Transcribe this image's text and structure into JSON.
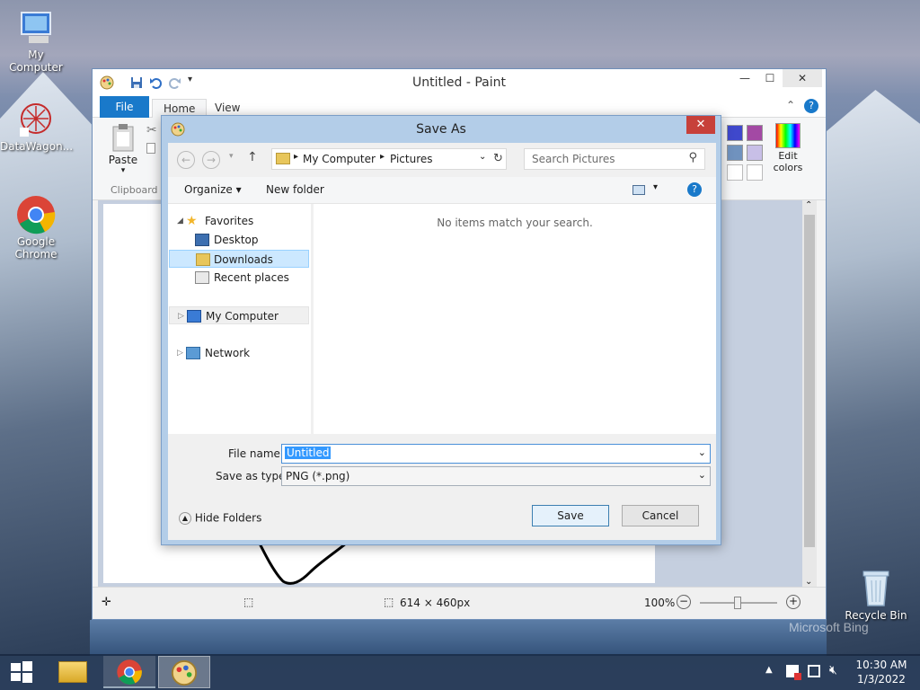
{
  "desktop": {
    "icons": [
      {
        "label": "My Computer"
      },
      {
        "label": "DataWagon..."
      },
      {
        "label_line1": "Google",
        "label_line2": "Chrome"
      },
      {
        "label": "Recycle Bin"
      }
    ],
    "watermark": "Microsoft Bing"
  },
  "paint": {
    "title": "Untitled - Paint",
    "tabs": {
      "file": "File",
      "home": "Home",
      "view": "View"
    },
    "clipboard": {
      "paste": "Paste",
      "group": "Clipboard"
    },
    "edit_colors": {
      "line1": "Edit",
      "line2": "colors"
    },
    "status": {
      "dimensions": "614 × 460px",
      "zoom": "100%"
    }
  },
  "dialog": {
    "title": "Save As",
    "breadcrumb": [
      "My Computer",
      "Pictures"
    ],
    "search_placeholder": "Search Pictures",
    "organize": "Organize",
    "new_folder": "New folder",
    "nav": {
      "favorites": "Favorites",
      "desktop": "Desktop",
      "downloads": "Downloads",
      "recent": "Recent places",
      "computer": "My Computer",
      "network": "Network"
    },
    "empty_message": "No items match your search.",
    "file_name_label": "File name:",
    "file_name_value": "Untitled",
    "save_type_label": "Save as type:",
    "save_type_value": "PNG (*.png)",
    "hide_folders": "Hide Folders",
    "save": "Save",
    "cancel": "Cancel"
  },
  "taskbar": {
    "time": "10:30 AM",
    "date": "1/3/2022"
  },
  "colors": {
    "accent": "#1979ca",
    "close": "#c7403a",
    "selection": "#cce8ff"
  }
}
